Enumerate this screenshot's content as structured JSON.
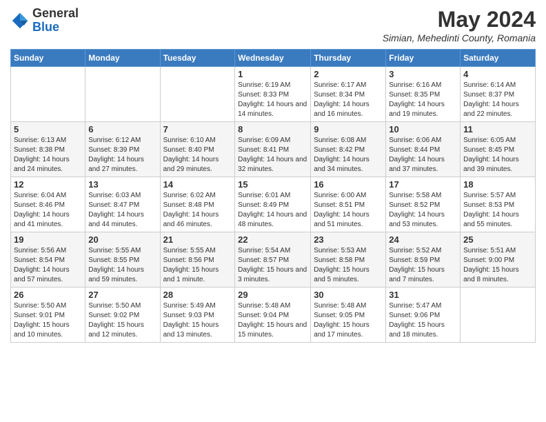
{
  "header": {
    "logo_general": "General",
    "logo_blue": "Blue",
    "month_year": "May 2024",
    "location": "Simian, Mehedinti County, Romania"
  },
  "weekdays": [
    "Sunday",
    "Monday",
    "Tuesday",
    "Wednesday",
    "Thursday",
    "Friday",
    "Saturday"
  ],
  "weeks": [
    [
      {
        "day": "",
        "info": ""
      },
      {
        "day": "",
        "info": ""
      },
      {
        "day": "",
        "info": ""
      },
      {
        "day": "1",
        "info": "Sunrise: 6:19 AM\nSunset: 8:33 PM\nDaylight: 14 hours and 14 minutes."
      },
      {
        "day": "2",
        "info": "Sunrise: 6:17 AM\nSunset: 8:34 PM\nDaylight: 14 hours and 16 minutes."
      },
      {
        "day": "3",
        "info": "Sunrise: 6:16 AM\nSunset: 8:35 PM\nDaylight: 14 hours and 19 minutes."
      },
      {
        "day": "4",
        "info": "Sunrise: 6:14 AM\nSunset: 8:37 PM\nDaylight: 14 hours and 22 minutes."
      }
    ],
    [
      {
        "day": "5",
        "info": "Sunrise: 6:13 AM\nSunset: 8:38 PM\nDaylight: 14 hours and 24 minutes."
      },
      {
        "day": "6",
        "info": "Sunrise: 6:12 AM\nSunset: 8:39 PM\nDaylight: 14 hours and 27 minutes."
      },
      {
        "day": "7",
        "info": "Sunrise: 6:10 AM\nSunset: 8:40 PM\nDaylight: 14 hours and 29 minutes."
      },
      {
        "day": "8",
        "info": "Sunrise: 6:09 AM\nSunset: 8:41 PM\nDaylight: 14 hours and 32 minutes."
      },
      {
        "day": "9",
        "info": "Sunrise: 6:08 AM\nSunset: 8:42 PM\nDaylight: 14 hours and 34 minutes."
      },
      {
        "day": "10",
        "info": "Sunrise: 6:06 AM\nSunset: 8:44 PM\nDaylight: 14 hours and 37 minutes."
      },
      {
        "day": "11",
        "info": "Sunrise: 6:05 AM\nSunset: 8:45 PM\nDaylight: 14 hours and 39 minutes."
      }
    ],
    [
      {
        "day": "12",
        "info": "Sunrise: 6:04 AM\nSunset: 8:46 PM\nDaylight: 14 hours and 41 minutes."
      },
      {
        "day": "13",
        "info": "Sunrise: 6:03 AM\nSunset: 8:47 PM\nDaylight: 14 hours and 44 minutes."
      },
      {
        "day": "14",
        "info": "Sunrise: 6:02 AM\nSunset: 8:48 PM\nDaylight: 14 hours and 46 minutes."
      },
      {
        "day": "15",
        "info": "Sunrise: 6:01 AM\nSunset: 8:49 PM\nDaylight: 14 hours and 48 minutes."
      },
      {
        "day": "16",
        "info": "Sunrise: 6:00 AM\nSunset: 8:51 PM\nDaylight: 14 hours and 51 minutes."
      },
      {
        "day": "17",
        "info": "Sunrise: 5:58 AM\nSunset: 8:52 PM\nDaylight: 14 hours and 53 minutes."
      },
      {
        "day": "18",
        "info": "Sunrise: 5:57 AM\nSunset: 8:53 PM\nDaylight: 14 hours and 55 minutes."
      }
    ],
    [
      {
        "day": "19",
        "info": "Sunrise: 5:56 AM\nSunset: 8:54 PM\nDaylight: 14 hours and 57 minutes."
      },
      {
        "day": "20",
        "info": "Sunrise: 5:55 AM\nSunset: 8:55 PM\nDaylight: 14 hours and 59 minutes."
      },
      {
        "day": "21",
        "info": "Sunrise: 5:55 AM\nSunset: 8:56 PM\nDaylight: 15 hours and 1 minute."
      },
      {
        "day": "22",
        "info": "Sunrise: 5:54 AM\nSunset: 8:57 PM\nDaylight: 15 hours and 3 minutes."
      },
      {
        "day": "23",
        "info": "Sunrise: 5:53 AM\nSunset: 8:58 PM\nDaylight: 15 hours and 5 minutes."
      },
      {
        "day": "24",
        "info": "Sunrise: 5:52 AM\nSunset: 8:59 PM\nDaylight: 15 hours and 7 minutes."
      },
      {
        "day": "25",
        "info": "Sunrise: 5:51 AM\nSunset: 9:00 PM\nDaylight: 15 hours and 8 minutes."
      }
    ],
    [
      {
        "day": "26",
        "info": "Sunrise: 5:50 AM\nSunset: 9:01 PM\nDaylight: 15 hours and 10 minutes."
      },
      {
        "day": "27",
        "info": "Sunrise: 5:50 AM\nSunset: 9:02 PM\nDaylight: 15 hours and 12 minutes."
      },
      {
        "day": "28",
        "info": "Sunrise: 5:49 AM\nSunset: 9:03 PM\nDaylight: 15 hours and 13 minutes."
      },
      {
        "day": "29",
        "info": "Sunrise: 5:48 AM\nSunset: 9:04 PM\nDaylight: 15 hours and 15 minutes."
      },
      {
        "day": "30",
        "info": "Sunrise: 5:48 AM\nSunset: 9:05 PM\nDaylight: 15 hours and 17 minutes."
      },
      {
        "day": "31",
        "info": "Sunrise: 5:47 AM\nSunset: 9:06 PM\nDaylight: 15 hours and 18 minutes."
      },
      {
        "day": "",
        "info": ""
      }
    ]
  ]
}
